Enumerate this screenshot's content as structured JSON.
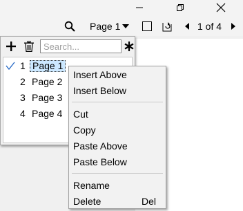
{
  "window": {
    "minimize_icon": "minimize-icon",
    "maximize_icon": "restore-icon",
    "close_icon": "close-icon"
  },
  "toolbar": {
    "search_icon": "magnifier-icon",
    "page_selector": "Page 1",
    "page_counter": "1 of 4"
  },
  "panel": {
    "add_icon": "plus-icon",
    "delete_icon": "trash-icon",
    "search_placeholder": "Search...",
    "options_icon": "asterisk-icon",
    "pages": [
      {
        "number": "1",
        "label": "Page 1",
        "current": true
      },
      {
        "number": "2",
        "label": "Page 2",
        "current": false
      },
      {
        "number": "3",
        "label": "Page 3",
        "current": false
      },
      {
        "number": "4",
        "label": "Page 4",
        "current": false
      }
    ]
  },
  "context_menu": {
    "insert_above": "Insert Above",
    "insert_below": "Insert Below",
    "cut": "Cut",
    "copy": "Copy",
    "paste_above": "Paste Above",
    "paste_below": "Paste Below",
    "rename": "Rename",
    "delete": "Delete",
    "delete_shortcut": "Del"
  },
  "colors": {
    "selection": "#cce8ff",
    "check": "#2a6cc7"
  }
}
